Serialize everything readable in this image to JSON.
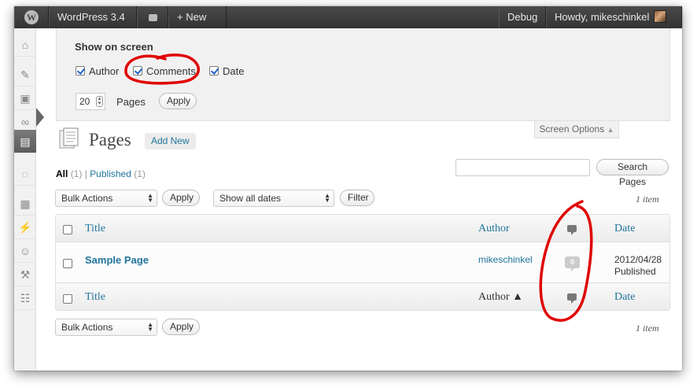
{
  "adminbar": {
    "site_name": "WordPress 3.4",
    "new_label": "+ New",
    "debug_label": "Debug",
    "howdy": "Howdy, mikeschinkel"
  },
  "sidebar": {
    "icons": [
      "dashboard-icon",
      "posts-pin-icon",
      "media-icon",
      "links-icon",
      "pages-icon",
      "comments-icon",
      "appearance-icon",
      "plugins-icon",
      "users-icon",
      "tools-icon",
      "settings-icon"
    ]
  },
  "screen_options": {
    "title": "Show on screen",
    "columns": [
      {
        "label": "Author",
        "checked": true
      },
      {
        "label": "Comments",
        "checked": true
      },
      {
        "label": "Date",
        "checked": true
      }
    ],
    "per_page_value": "20",
    "per_page_label": "Pages",
    "apply_label": "Apply",
    "tab_label": "Screen Options"
  },
  "heading": {
    "title": "Pages",
    "add_new": "Add New"
  },
  "filters": {
    "all_label": "All",
    "all_count": "(1)",
    "separator": "|",
    "published_label": "Published",
    "published_count": "(1)",
    "search_button": "Search Pages",
    "bulk_actions": "Bulk Actions",
    "apply": "Apply",
    "dates": "Show all dates",
    "filter": "Filter",
    "item_count": "1 item"
  },
  "table": {
    "columns": {
      "title": "Title",
      "author": "Author",
      "date": "Date"
    },
    "footer_author": "Author ▲",
    "rows": [
      {
        "title": "Sample Page",
        "author": "mikeschinkel",
        "comments": "0",
        "date": "2012/04/28",
        "status": "Published"
      }
    ]
  },
  "colors": {
    "link": "#21759b",
    "annotation": "#e00000"
  }
}
